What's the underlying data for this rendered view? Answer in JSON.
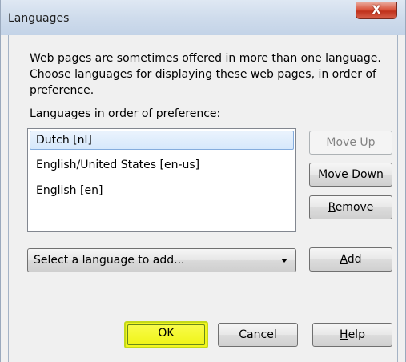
{
  "window": {
    "title": "Languages",
    "close_label": "X"
  },
  "description": "Web pages are sometimes offered in more than one language. Choose languages for displaying these web pages, in order of preference.",
  "list": {
    "label": "Languages in order of preference:",
    "items": [
      {
        "label": "Dutch  [nl]",
        "selected": true
      },
      {
        "label": "English/United States  [en-us]",
        "selected": false
      },
      {
        "label": "English  [en]",
        "selected": false
      }
    ]
  },
  "buttons": {
    "move_up": {
      "pre": "Move ",
      "accel": "U",
      "post": "p",
      "enabled": false
    },
    "move_down": {
      "pre": "Move ",
      "accel": "D",
      "post": "own",
      "enabled": true
    },
    "remove": {
      "pre": "",
      "accel": "R",
      "post": "emove",
      "enabled": true
    },
    "add": {
      "pre": "",
      "accel": "A",
      "post": "dd",
      "enabled": true
    },
    "ok": {
      "label": "OK",
      "highlighted": true
    },
    "cancel": {
      "label": "Cancel"
    },
    "help": {
      "pre": "",
      "accel": "H",
      "post": "elp"
    }
  },
  "language_select": {
    "value": "Select a language to add..."
  },
  "colors": {
    "highlight": "#f3f61e",
    "selection": "#d6e8fc"
  }
}
